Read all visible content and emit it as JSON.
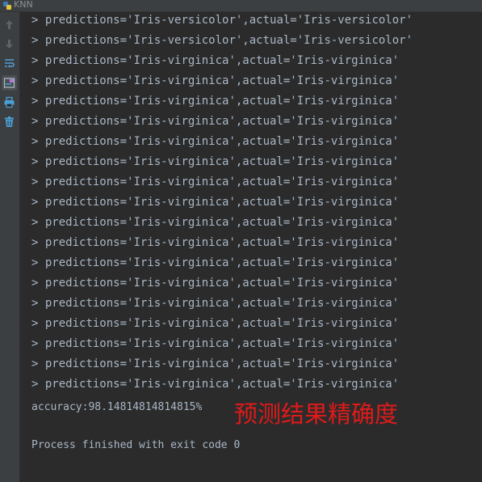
{
  "window": {
    "title": "KNN"
  },
  "toolbar": {
    "icons": [
      "up-arrow-icon",
      "down-arrow-icon",
      "soft-wrap-icon",
      "scroll-to-end-icon",
      "print-icon",
      "trash-icon"
    ]
  },
  "console": {
    "prompt": ">",
    "lines": [
      "predictions='Iris-versicolor',actual='Iris-versicolor'",
      "predictions='Iris-versicolor',actual='Iris-versicolor'",
      "predictions='Iris-virginica',actual='Iris-virginica'",
      "predictions='Iris-virginica',actual='Iris-virginica'",
      "predictions='Iris-virginica',actual='Iris-virginica'",
      "predictions='Iris-virginica',actual='Iris-virginica'",
      "predictions='Iris-virginica',actual='Iris-virginica'",
      "predictions='Iris-virginica',actual='Iris-virginica'",
      "predictions='Iris-virginica',actual='Iris-virginica'",
      "predictions='Iris-virginica',actual='Iris-virginica'",
      "predictions='Iris-virginica',actual='Iris-virginica'",
      "predictions='Iris-virginica',actual='Iris-virginica'",
      "predictions='Iris-virginica',actual='Iris-virginica'",
      "predictions='Iris-virginica',actual='Iris-virginica'",
      "predictions='Iris-virginica',actual='Iris-virginica'",
      "predictions='Iris-virginica',actual='Iris-virginica'",
      "predictions='Iris-virginica',actual='Iris-virginica'",
      "predictions='Iris-virginica',actual='Iris-virginica'",
      "predictions='Iris-virginica',actual='Iris-virginica'"
    ],
    "accuracy": "accuracy:98.14814814814815%",
    "annotation": "预测结果精确度",
    "finish": "Process finished with exit code 0"
  },
  "colors": {
    "background": "#2b2b2b",
    "toolbar": "#3c3f41",
    "text": "#a9b7c6",
    "annotation": "#e01a1a"
  }
}
